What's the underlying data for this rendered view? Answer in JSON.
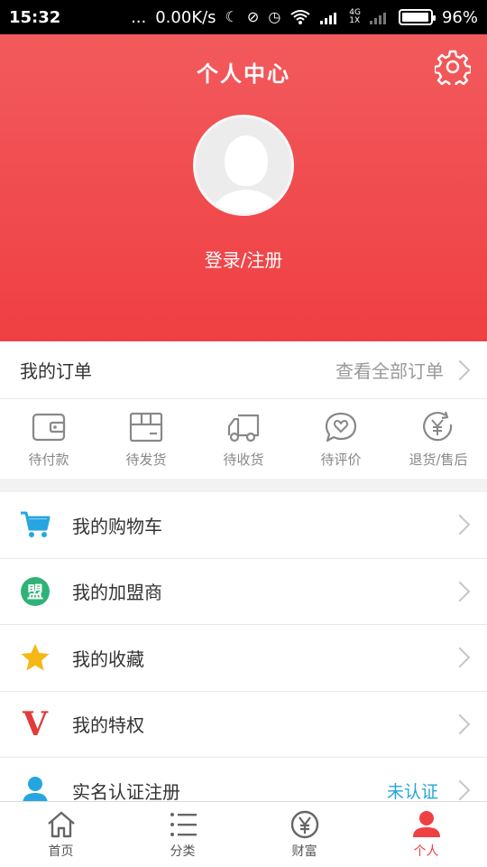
{
  "status_bar": {
    "time": "15:32",
    "dots": "...",
    "speed": "0.00K/s",
    "network": "4G",
    "network_sub": "1X",
    "battery": "96%"
  },
  "header": {
    "title": "个人中心",
    "login": "登录/注册"
  },
  "orders": {
    "label": "我的订单",
    "view_all": "查看全部订单",
    "statuses": [
      {
        "label": "待付款",
        "icon": "wallet-icon"
      },
      {
        "label": "待发货",
        "icon": "box-icon"
      },
      {
        "label": "待收货",
        "icon": "truck-icon"
      },
      {
        "label": "待评价",
        "icon": "comment-heart-icon"
      },
      {
        "label": "退货/售后",
        "icon": "refund-icon"
      }
    ]
  },
  "menu": {
    "items": [
      {
        "label": "我的购物车",
        "icon": "cart-icon",
        "color": "#26a6e0"
      },
      {
        "label": "我的加盟商",
        "icon": "franchise-badge-icon",
        "glyph": "盟",
        "color": "#2fb277"
      },
      {
        "label": "我的收藏",
        "icon": "star-icon",
        "color": "#f5b814"
      },
      {
        "label": "我的特权",
        "icon": "v-icon",
        "glyph": "V",
        "color": "#e23b3b"
      },
      {
        "label": "实名认证注册",
        "icon": "user-icon",
        "color": "#26a6e0",
        "badge": "未认证"
      }
    ]
  },
  "tabbar": {
    "tabs": [
      {
        "label": "首页",
        "icon": "home-icon"
      },
      {
        "label": "分类",
        "icon": "list-icon"
      },
      {
        "label": "财富",
        "icon": "yen-icon"
      },
      {
        "label": "个人",
        "icon": "person-icon",
        "active": true
      }
    ]
  },
  "colors": {
    "brand_red": "#ef4043",
    "link_blue": "#25a7d8"
  }
}
